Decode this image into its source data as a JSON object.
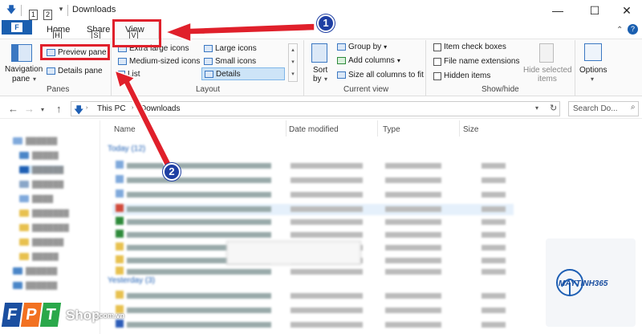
{
  "window": {
    "title": "Downloads",
    "keytips": [
      "1",
      "2"
    ],
    "controls": [
      "—",
      "☐",
      "✕"
    ]
  },
  "ribbon_tabs": [
    {
      "label": "F",
      "keytip": ""
    },
    {
      "label": "Home",
      "keytip": "H"
    },
    {
      "label": "Share",
      "keytip": "S"
    },
    {
      "label": "View",
      "keytip": "V"
    }
  ],
  "panes": {
    "navigation_pane_line1": "Navigation",
    "navigation_pane_line2": "pane",
    "preview_pane": "Preview pane",
    "details_pane": "Details pane",
    "group_label": "Panes"
  },
  "layout": {
    "extra_large_icons": "Extra large icons",
    "large_icons": "Large icons",
    "medium_icons": "Medium-sized icons",
    "small_icons": "Small icons",
    "list": "List",
    "details": "Details",
    "group_label": "Layout"
  },
  "current_view": {
    "sort_by_line1": "Sort",
    "sort_by_line2": "by",
    "group_by": "Group by",
    "add_columns": "Add columns",
    "size_all_columns": "Size all columns to fit",
    "group_label": "Current view"
  },
  "show_hide": {
    "item_check_boxes": "Item check boxes",
    "file_name_extensions": "File name extensions",
    "hidden_items": "Hidden items",
    "hide_selected_line1": "Hide selected",
    "hide_selected_line2": "items",
    "group_label": "Show/hide"
  },
  "options": {
    "label": "Options"
  },
  "address": {
    "path_root": "This PC",
    "path_folder": "Downloads",
    "search_placeholder": "Search Do..."
  },
  "columns": {
    "name": "Name",
    "date_modified": "Date modified",
    "type": "Type",
    "size": "Size"
  },
  "file_groups": {
    "today": "Today",
    "yesterday": "Yesterday"
  },
  "annotations": {
    "badge_1": "1",
    "badge_2": "2"
  },
  "branding": {
    "fpt_letters": "FPT",
    "shop": "Shop",
    "domain": ".com.vn",
    "partner": "MAYTINH365"
  },
  "colors": {
    "accent_blue": "#1a5fb0",
    "annotation_red": "#e0202b",
    "badge_blue": "#1f3fa3",
    "fpt_blue": "#1b4fa0",
    "fpt_orange": "#f27121",
    "fpt_green": "#2aa84a"
  }
}
